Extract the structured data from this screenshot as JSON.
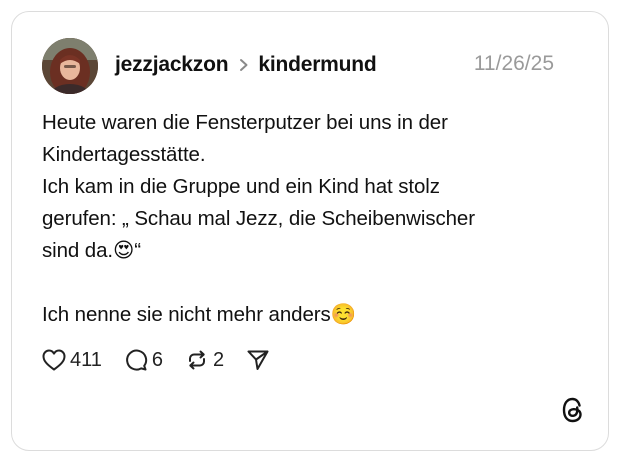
{
  "post": {
    "author": "jezzjackzon",
    "community": "kindermund",
    "date": "11/26/25",
    "lines": [
      "Heute waren die Fensterputzer bei uns in der",
      "Kindertagesstätte.",
      "Ich kam in die Gruppe und ein Kind hat stolz",
      "gerufen: „ Schau mal Jezz, die Scheibenwischer",
      "sind da.😍“",
      "",
      "Ich nenne sie nicht mehr anders☺️"
    ]
  },
  "actions": {
    "likes": "411",
    "comments": "6",
    "reposts": "2"
  },
  "icons": {
    "like": "heart-icon",
    "comment": "comment-bubble-icon",
    "repost": "repost-icon",
    "share": "send-icon",
    "separator": "chevron-right-icon",
    "brand": "threads-logo-icon"
  }
}
